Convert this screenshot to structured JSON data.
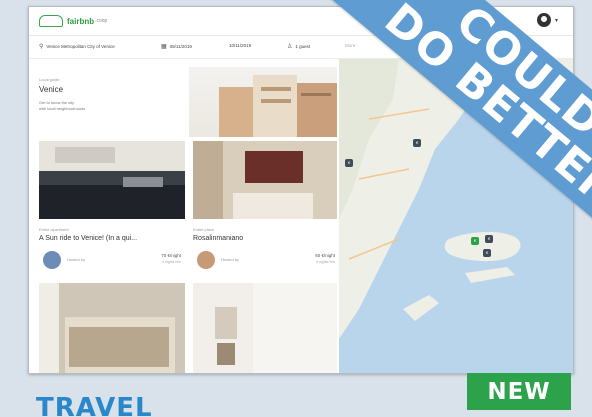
{
  "app": {
    "logo_text": "fairbnb",
    "logo_sub": ".coop"
  },
  "filters": {
    "location": "Venice Metropolitan City of Venice",
    "dates": "08/11/2019",
    "dates_to": "10/11/2019",
    "guests": "1 guest",
    "more": "More"
  },
  "intro": {
    "small": "Local guide",
    "title": "Venice",
    "desc_line1": "Get to know the city",
    "desc_line2": "with local neighbourhoods"
  },
  "listings": [
    {
      "small": "Entire apartment",
      "title": "A Sun ride to Venice! (In a qui...",
      "host": "Hosted by",
      "price": "70 €/night",
      "price_sub": "4 nights min"
    },
    {
      "small": "Entire place",
      "title": "Rosalinmaniano",
      "host": "Hosted by",
      "price": "60 €/night",
      "price_sub": "4 nights min"
    }
  ],
  "overlay": {
    "ribbon_line1": "COULD",
    "ribbon_line2": "DO BETTER",
    "category": "TRAVEL",
    "badge": "NEW"
  },
  "colors": {
    "ribbon": "#5e9cd2",
    "badge": "#2ca24a",
    "category": "#2a87c8",
    "brand": "#3aa54a",
    "map_water": "#b9d5ec",
    "map_land": "#eef0e8"
  },
  "icons": [
    "location-pin-icon",
    "calendar-icon",
    "user-icon",
    "user-avatar-icon",
    "chevron-down-icon"
  ]
}
